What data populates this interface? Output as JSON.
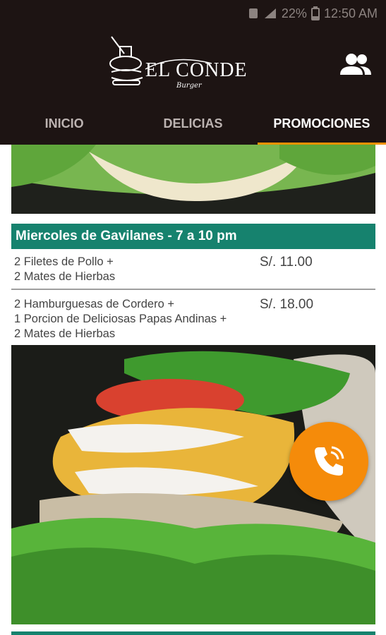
{
  "status_bar": {
    "battery": "22%",
    "time": "12:50 AM"
  },
  "app": {
    "logo_text": "EL CONDE",
    "logo_sub": "Burger"
  },
  "tabs": [
    {
      "label": "INICIO",
      "active": false
    },
    {
      "label": "DELICIAS",
      "active": false
    },
    {
      "label": "PROMOCIONES",
      "active": true
    }
  ],
  "promo": {
    "title": "Miercoles de Gavilanes  - 7 a 10 pm",
    "items": [
      {
        "description": "2 Filetes de Pollo +\n2 Mates de Hierbas",
        "price": "S/.   11.00"
      },
      {
        "description": "2 Hamburguesas de Cordero +\n1 Porcion de Deliciosas Papas Andinas +\n2 Mates de Hierbas",
        "price": "S/.   18.00"
      }
    ]
  },
  "colors": {
    "topbar": "#1d1413",
    "accent": "#f39200",
    "promo_header": "#16826e",
    "fab": "#f58b0a"
  },
  "icons": {
    "users": "users-icon",
    "call": "phone-icon"
  }
}
